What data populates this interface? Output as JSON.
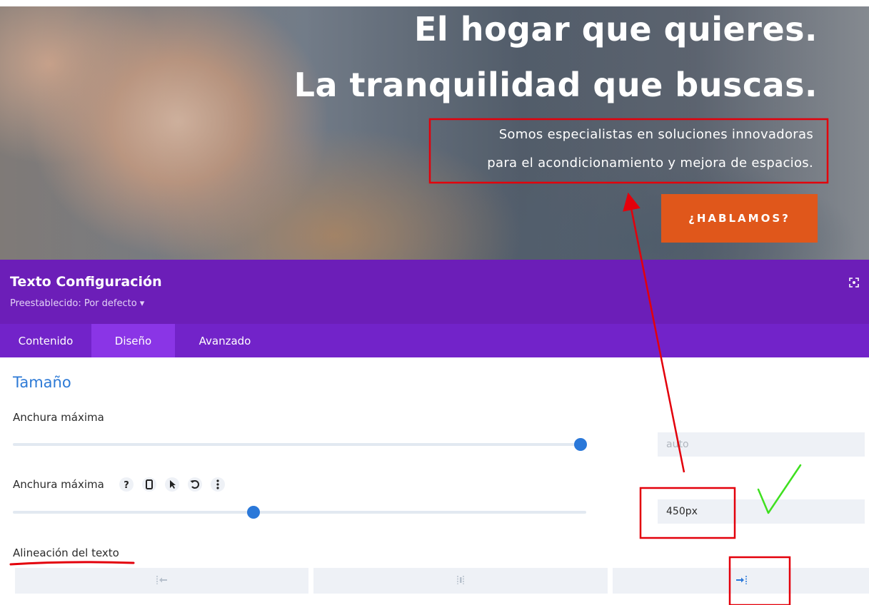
{
  "hero": {
    "title_line_1": "El hogar que quieres.",
    "title_line_2": "La tranquilidad que buscas.",
    "subtitle_line_1": "Somos especialistas en soluciones innovadoras",
    "subtitle_line_2": "para el acondicionamiento y mejora de espacios.",
    "cta_label": "¿HABLAMOS?",
    "cta_color": "#e0571b"
  },
  "settings": {
    "title": "Texto Configuración",
    "preset": "Preestablecido: Por defecto ▾",
    "header_color": "#6c1eb8",
    "expand_icon": "expand-icon"
  },
  "tabs": [
    {
      "label": "Contenido",
      "active": false
    },
    {
      "label": "Diseño",
      "active": true
    },
    {
      "label": "Avanzado",
      "active": false
    }
  ],
  "section": {
    "title": "Tamaño"
  },
  "fields": {
    "max_width_1": {
      "label": "Anchura máxima",
      "slider_level": 1.0,
      "placeholder": "auto"
    },
    "max_width_2": {
      "label": "Anchura máxima",
      "slider_level": 0.42,
      "value": "450px",
      "option_icons": [
        "help-icon",
        "phone-icon",
        "cursor-icon",
        "reset-icon",
        "more-icon"
      ]
    },
    "text_align": {
      "label": "Alineación del texto",
      "options": [
        "align-left-icon",
        "align-center-icon",
        "align-right-icon"
      ],
      "selected": "align-right-icon"
    }
  },
  "annotation_colors": {
    "box": "#e3000b",
    "check": "#3fe020"
  }
}
